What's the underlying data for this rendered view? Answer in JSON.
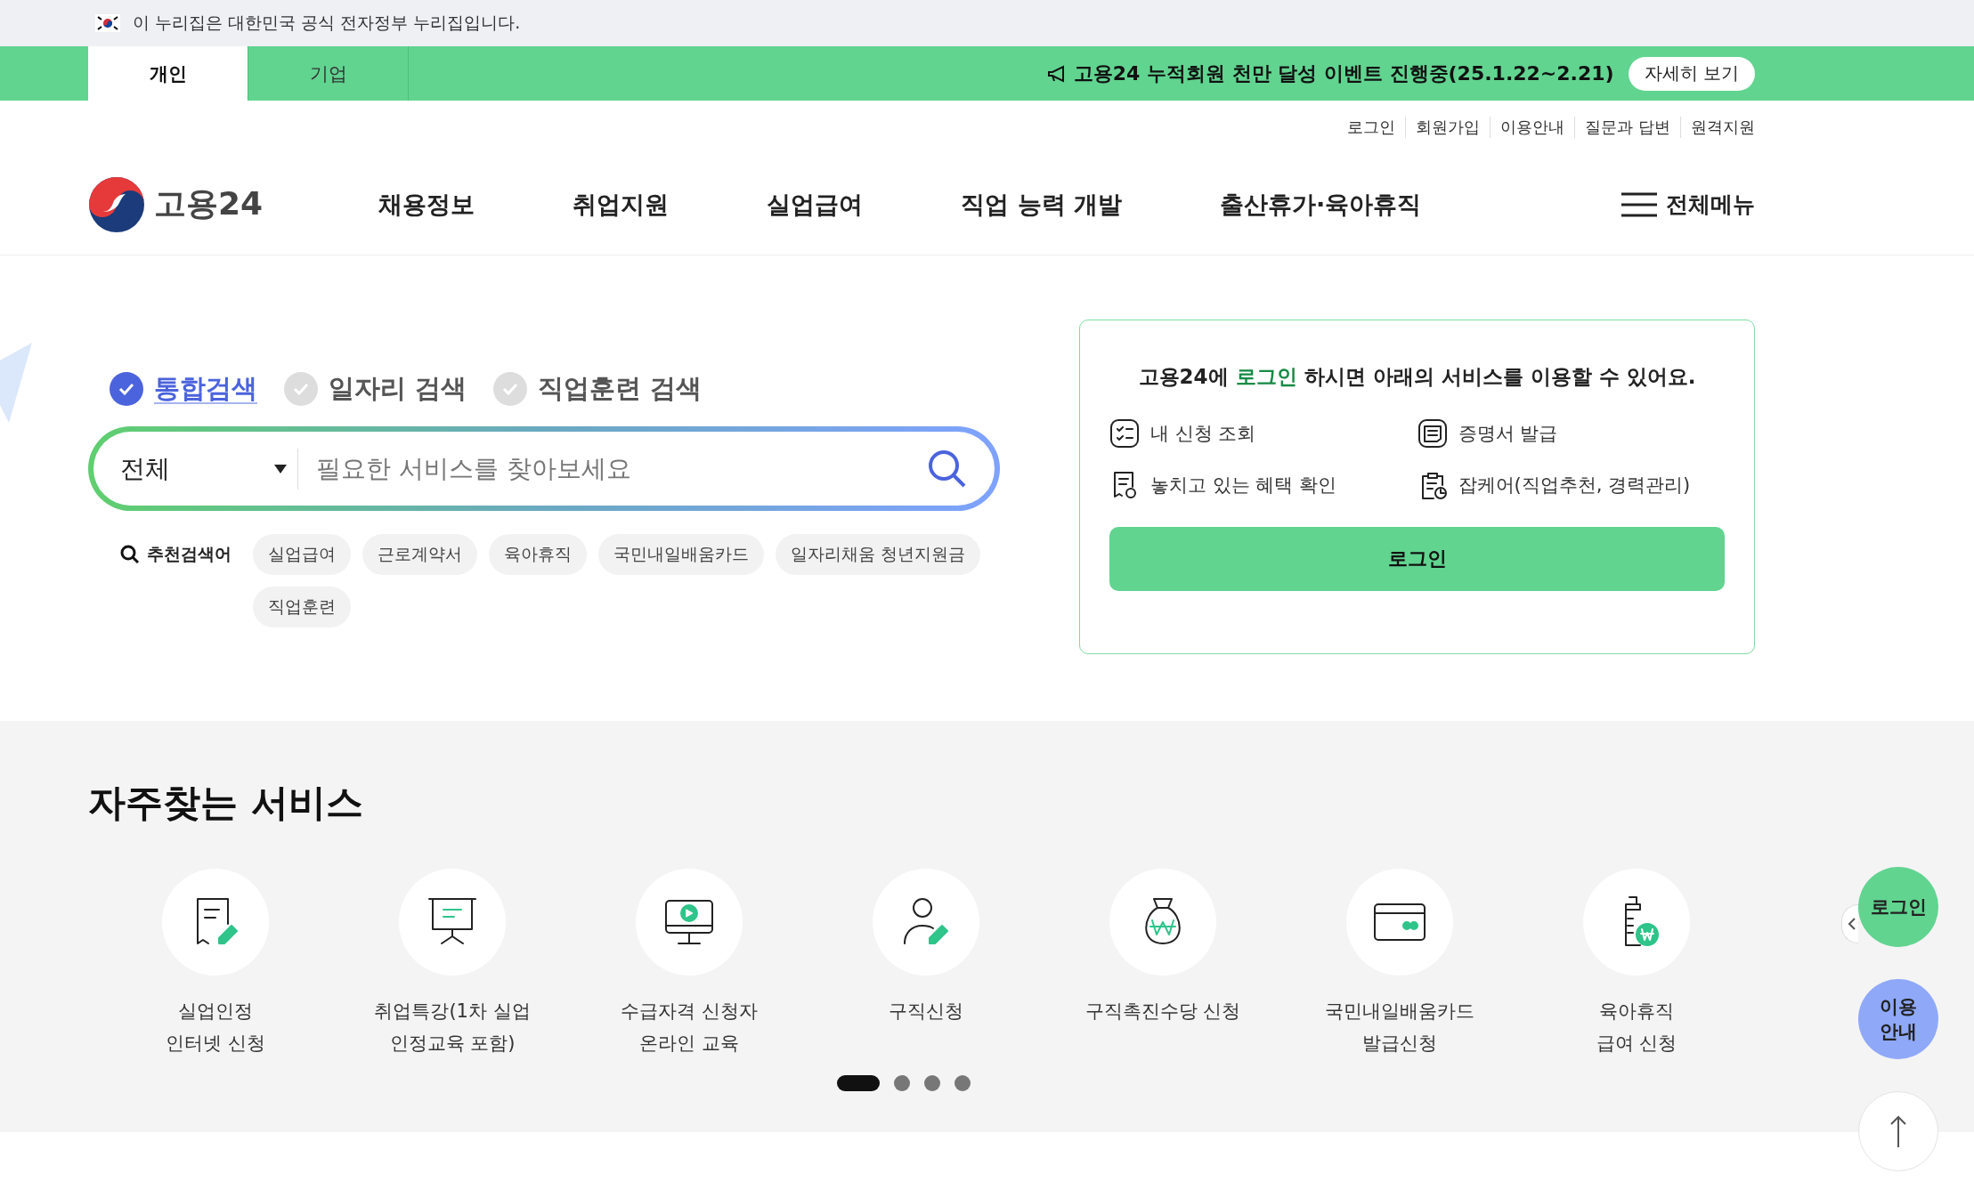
{
  "gov_banner": {
    "text": "이 누리집은 대한민국 공식 전자정부 누리집입니다."
  },
  "audience_tabs": [
    {
      "label": "개인",
      "selected": true
    },
    {
      "label": "기업",
      "selected": false
    }
  ],
  "event_banner": {
    "text": "고용24 누적회원 천만 달성 이벤트 진행중(25.1.22~2.21)",
    "button": "자세히 보기"
  },
  "util_links": [
    "로그인",
    "회원가입",
    "이용안내",
    "질문과 답변",
    "원격지원"
  ],
  "logo": {
    "text": "고용24"
  },
  "nav": [
    "채용정보",
    "취업지원",
    "실업급여",
    "직업 능력 개발",
    "출산휴가·육아휴직"
  ],
  "all_menu": "전체메뉴",
  "search_tabs": [
    {
      "label": "통합검색",
      "selected": true
    },
    {
      "label": "일자리 검색",
      "selected": false
    },
    {
      "label": "직업훈련 검색",
      "selected": false
    }
  ],
  "search": {
    "category": "전체",
    "placeholder": "필요한 서비스를 찾아보세요"
  },
  "recommended": {
    "label": "추천검색어",
    "keywords": [
      "실업급여",
      "근로계약서",
      "육아휴직",
      "국민내일배움카드",
      "일자리채움 청년지원금",
      "직업훈련"
    ]
  },
  "login_card": {
    "title": "고용24에 **로그인** 하시면 아래의 서비스를 이용할 수 있어요.",
    "services": [
      {
        "kind": "checklist",
        "label": "내 신청 조회"
      },
      {
        "kind": "certificate",
        "label": "증명서 발급"
      },
      {
        "kind": "receipt",
        "label": "놓치고 있는 혜택 확인"
      },
      {
        "kind": "clipboard",
        "label": "잡케어(직업추천, 경력관리)"
      }
    ],
    "button": "로그인"
  },
  "frequent": {
    "title": "자주찾는 서비스",
    "items": [
      {
        "kind": "doc-pen",
        "lines": [
          "실업인정",
          "인터넷 신청"
        ]
      },
      {
        "kind": "board",
        "lines": [
          "취업특강(1차 실업",
          "인정교육 포함)"
        ]
      },
      {
        "kind": "monitor",
        "lines": [
          "수급자격 신청자",
          "온라인 교육"
        ]
      },
      {
        "kind": "person-pen",
        "lines": [
          "구직신청"
        ]
      },
      {
        "kind": "money-bag",
        "lines": [
          "구직촉진수당 신청"
        ]
      },
      {
        "kind": "card",
        "lines": [
          "국민내일배움카드",
          "발급신청"
        ]
      },
      {
        "kind": "bottle",
        "lines": [
          "육아휴직",
          "급여 신청"
        ]
      }
    ],
    "pages": [
      {
        "selected": true
      },
      {
        "selected": false
      },
      {
        "selected": false
      },
      {
        "selected": false
      }
    ]
  },
  "floating": {
    "login": "로그인",
    "guide": [
      "이용",
      "안내"
    ]
  }
}
